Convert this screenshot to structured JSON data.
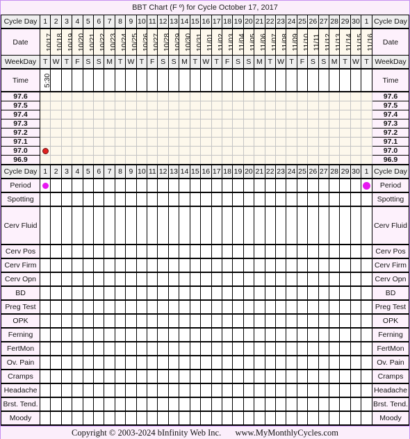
{
  "title": "BBT Chart (F º) for Cycle October 17, 2017",
  "labels": {
    "cycle_day": "Cycle Day",
    "date": "Date",
    "weekday": "WeekDay",
    "time": "Time"
  },
  "days": [
    {
      "cycle_day": "1",
      "date": "10/17",
      "weekday": "T",
      "time": "5:30",
      "temp": "97.0",
      "period": true
    },
    {
      "cycle_day": "2",
      "date": "10/18",
      "weekday": "W",
      "time": "",
      "temp": null,
      "period": false
    },
    {
      "cycle_day": "3",
      "date": "10/19",
      "weekday": "T",
      "time": "",
      "temp": null,
      "period": false
    },
    {
      "cycle_day": "4",
      "date": "10/20",
      "weekday": "F",
      "time": "",
      "temp": null,
      "period": false
    },
    {
      "cycle_day": "5",
      "date": "10/21",
      "weekday": "S",
      "time": "",
      "temp": null,
      "period": false
    },
    {
      "cycle_day": "6",
      "date": "10/22",
      "weekday": "S",
      "time": "",
      "temp": null,
      "period": false
    },
    {
      "cycle_day": "7",
      "date": "10/23",
      "weekday": "M",
      "time": "",
      "temp": null,
      "period": false
    },
    {
      "cycle_day": "8",
      "date": "10/24",
      "weekday": "T",
      "time": "",
      "temp": null,
      "period": false
    },
    {
      "cycle_day": "9",
      "date": "10/25",
      "weekday": "W",
      "time": "",
      "temp": null,
      "period": false
    },
    {
      "cycle_day": "10",
      "date": "10/26",
      "weekday": "T",
      "time": "",
      "temp": null,
      "period": false
    },
    {
      "cycle_day": "11",
      "date": "10/27",
      "weekday": "F",
      "time": "",
      "temp": null,
      "period": false
    },
    {
      "cycle_day": "12",
      "date": "10/28",
      "weekday": "S",
      "time": "",
      "temp": null,
      "period": false
    },
    {
      "cycle_day": "13",
      "date": "10/29",
      "weekday": "S",
      "time": "",
      "temp": null,
      "period": false
    },
    {
      "cycle_day": "14",
      "date": "10/30",
      "weekday": "M",
      "time": "",
      "temp": null,
      "period": false
    },
    {
      "cycle_day": "15",
      "date": "10/31",
      "weekday": "T",
      "time": "",
      "temp": null,
      "period": false
    },
    {
      "cycle_day": "16",
      "date": "11/01",
      "weekday": "W",
      "time": "",
      "temp": null,
      "period": false
    },
    {
      "cycle_day": "17",
      "date": "11/02",
      "weekday": "T",
      "time": "",
      "temp": null,
      "period": false
    },
    {
      "cycle_day": "18",
      "date": "11/03",
      "weekday": "F",
      "time": "",
      "temp": null,
      "period": false
    },
    {
      "cycle_day": "19",
      "date": "11/04",
      "weekday": "S",
      "time": "",
      "temp": null,
      "period": false
    },
    {
      "cycle_day": "20",
      "date": "11/05",
      "weekday": "S",
      "time": "",
      "temp": null,
      "period": false
    },
    {
      "cycle_day": "21",
      "date": "11/06",
      "weekday": "M",
      "time": "",
      "temp": null,
      "period": false
    },
    {
      "cycle_day": "22",
      "date": "11/07",
      "weekday": "T",
      "time": "",
      "temp": null,
      "period": false
    },
    {
      "cycle_day": "23",
      "date": "11/08",
      "weekday": "W",
      "time": "",
      "temp": null,
      "period": false
    },
    {
      "cycle_day": "24",
      "date": "11/09",
      "weekday": "T",
      "time": "",
      "temp": null,
      "period": false
    },
    {
      "cycle_day": "25",
      "date": "11/10",
      "weekday": "F",
      "time": "",
      "temp": null,
      "period": false
    },
    {
      "cycle_day": "26",
      "date": "11/11",
      "weekday": "S",
      "time": "",
      "temp": null,
      "period": false
    },
    {
      "cycle_day": "27",
      "date": "11/12",
      "weekday": "S",
      "time": "",
      "temp": null,
      "period": false
    },
    {
      "cycle_day": "28",
      "date": "11/13",
      "weekday": "M",
      "time": "",
      "temp": null,
      "period": false
    },
    {
      "cycle_day": "29",
      "date": "11/14",
      "weekday": "T",
      "time": "",
      "temp": null,
      "period": false
    },
    {
      "cycle_day": "30",
      "date": "11/15",
      "weekday": "W",
      "time": "",
      "temp": null,
      "period": false
    },
    {
      "cycle_day": "1",
      "date": "11/16",
      "weekday": "T",
      "time": "",
      "temp": null,
      "period": true
    }
  ],
  "temperatures": [
    "97.6",
    "97.5",
    "97.4",
    "97.3",
    "97.2",
    "97.1",
    "97.0",
    "96.9"
  ],
  "observations": [
    {
      "key": "period",
      "label": "Period",
      "tall": false
    },
    {
      "key": "spotting",
      "label": "Spotting",
      "tall": false
    },
    {
      "key": "cerv_fluid",
      "label": "Cerv Fluid",
      "tall": true
    },
    {
      "key": "cerv_pos",
      "label": "Cerv Pos",
      "tall": false
    },
    {
      "key": "cerv_firm",
      "label": "Cerv Firm",
      "tall": false
    },
    {
      "key": "cerv_opn",
      "label": "Cerv Opn",
      "tall": false
    },
    {
      "key": "bd",
      "label": "BD",
      "tall": false
    },
    {
      "key": "preg_test",
      "label": "Preg Test",
      "tall": false
    },
    {
      "key": "opk",
      "label": "OPK",
      "tall": false
    },
    {
      "key": "ferning",
      "label": "Ferning",
      "tall": false
    },
    {
      "key": "fertmon",
      "label": "FertMon",
      "tall": false
    },
    {
      "key": "ov_pain",
      "label": "Ov. Pain",
      "tall": false
    },
    {
      "key": "cramps",
      "label": "Cramps",
      "tall": false
    },
    {
      "key": "headache",
      "label": "Headache",
      "tall": false
    },
    {
      "key": "brst_tend",
      "label": "Brst. Tend.",
      "tall": false
    },
    {
      "key": "moody",
      "label": "Moody",
      "tall": false
    }
  ],
  "colors": {
    "temp_dot": "#e02020",
    "period_dot": "#e619f0",
    "frame": "#c58ff0"
  },
  "footer": {
    "copyright": "Copyright © 2003-2024 bInfinity Web Inc.",
    "site": "www.MyMonthlyCycles.com"
  }
}
